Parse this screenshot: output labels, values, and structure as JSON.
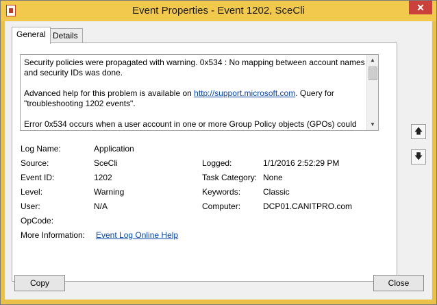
{
  "window": {
    "title": "Event Properties - Event 1202, SceCli",
    "close_glyph": "✕"
  },
  "tabs": [
    {
      "label": "General",
      "active": true
    },
    {
      "label": "Details",
      "active": false
    }
  ],
  "description": {
    "para1": "Security policies were propagated with warning. 0x534 : No mapping between account names and security IDs was done.",
    "para2_prefix": "Advanced help for this problem is available on ",
    "para2_link": "http://support.microsoft.com",
    "para2_suffix": ". Query for \"troubleshooting 1202 events\".",
    "para3": "Error 0x534 occurs when a user account in one or more Group Policy objects (GPOs) could not"
  },
  "fields": {
    "log_name_label": "Log Name:",
    "log_name_value": "Application",
    "source_label": "Source:",
    "source_value": "SceCli",
    "logged_label": "Logged:",
    "logged_value": "1/1/2016 2:52:29 PM",
    "event_id_label": "Event ID:",
    "event_id_value": "1202",
    "task_category_label": "Task Category:",
    "task_category_value": "None",
    "level_label": "Level:",
    "level_value": "Warning",
    "keywords_label": "Keywords:",
    "keywords_value": "Classic",
    "user_label": "User:",
    "user_value": "N/A",
    "computer_label": "Computer:",
    "computer_value": "DCP01.CANITPRO.com",
    "opcode_label": "OpCode:",
    "more_info_label": "More Information:",
    "more_info_link": "Event Log Online Help"
  },
  "nav": {
    "up_glyph": "🡅",
    "down_glyph": "🡇"
  },
  "buttons": {
    "copy": "Copy",
    "close": "Close"
  },
  "colors": {
    "titlebar": "#f2c94c",
    "close_button": "#c9413a",
    "link": "#0645ad"
  }
}
